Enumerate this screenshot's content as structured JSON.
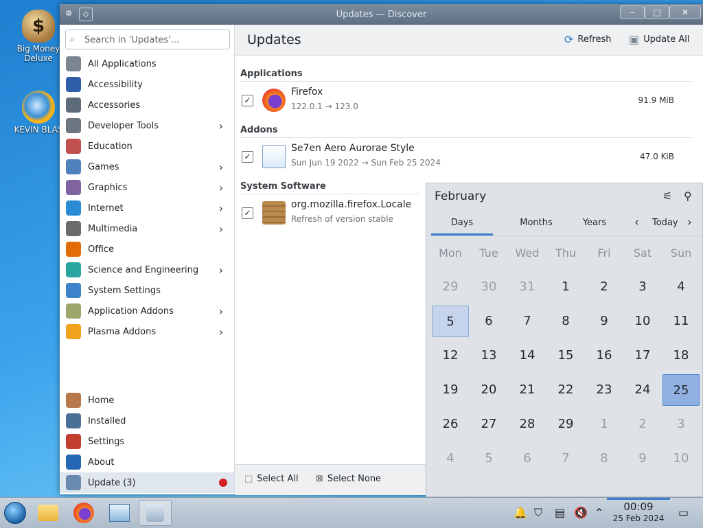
{
  "desktop": {
    "icons": [
      {
        "label": "Big Money Deluxe",
        "glyph": "$"
      },
      {
        "label": "KEVIN BLAS"
      }
    ]
  },
  "window": {
    "title": "Updates — Discover"
  },
  "sidebar": {
    "search_placeholder": "Search in 'Updates'...",
    "categories": [
      {
        "label": "All Applications",
        "icon": "grid-icon",
        "color": "#7a8591"
      },
      {
        "label": "Accessibility",
        "icon": "accessibility-icon",
        "color": "#2f5ea8"
      },
      {
        "label": "Accessories",
        "icon": "accessories-icon",
        "color": "#5d6b7a"
      },
      {
        "label": "Developer Tools",
        "icon": "developer-tools-icon",
        "color": "#6d7680"
      },
      {
        "label": "Education",
        "icon": "education-icon",
        "color": "#c0504d"
      },
      {
        "label": "Games",
        "icon": "games-icon",
        "color": "#4f81bd"
      },
      {
        "label": "Graphics",
        "icon": "graphics-icon",
        "color": "#8064a2"
      },
      {
        "label": "Internet",
        "icon": "internet-icon",
        "color": "#2a8ad4"
      },
      {
        "label": "Multimedia",
        "icon": "multimedia-icon",
        "color": "#6b6b6b"
      },
      {
        "label": "Office",
        "icon": "office-icon",
        "color": "#e36c09"
      },
      {
        "label": "Science and Engineering",
        "icon": "science-icon",
        "color": "#2aa6a0"
      },
      {
        "label": "System Settings",
        "icon": "system-settings-icon",
        "color": "#3c83c9"
      },
      {
        "label": "Application Addons",
        "icon": "application-addons-icon",
        "color": "#9ea56b"
      },
      {
        "label": "Plasma Addons",
        "icon": "plasma-addons-icon",
        "color": "#f0a21a"
      }
    ],
    "bottom": [
      {
        "label": "Home",
        "icon": "home-icon",
        "color": "#b9784a"
      },
      {
        "label": "Installed",
        "icon": "installed-icon",
        "color": "#4a6f97"
      },
      {
        "label": "Settings",
        "icon": "settings-icon",
        "color": "#c33d2e"
      },
      {
        "label": "About",
        "icon": "about-icon",
        "color": "#2566b5"
      },
      {
        "label": "Update (3)",
        "icon": "update-icon",
        "color": "#6a8bb0"
      }
    ]
  },
  "main": {
    "title": "Updates",
    "refresh": "Refresh",
    "update_all": "Update All",
    "sections": [
      {
        "label": "Applications"
      },
      {
        "label": "Addons"
      },
      {
        "label": "System Software"
      }
    ],
    "updates": [
      {
        "name": "Firefox",
        "sub": "122.0.1 → 123.0",
        "size": "91.9 MiB",
        "checked": "✓"
      },
      {
        "name": "Se7en Aero Aurorae Style",
        "sub": "Sun Jun 19 2022 → Sun Feb 25 2024",
        "size": "47.0 KiB",
        "checked": "✓"
      },
      {
        "name": "org.mozilla.firefox.Locale",
        "sub": "Refresh of version stable",
        "size": "",
        "checked": "✓"
      }
    ],
    "select_all": "Select All",
    "select_none": "Select None"
  },
  "calendar": {
    "month": "February",
    "tabs": [
      "Days",
      "Months",
      "Years"
    ],
    "today": "Today",
    "weekdays": [
      "Mon",
      "Tue",
      "Wed",
      "Thu",
      "Fri",
      "Sat",
      "Sun"
    ],
    "days": [
      "29",
      "30",
      "31",
      "1",
      "2",
      "3",
      "4",
      "5",
      "6",
      "7",
      "8",
      "9",
      "10",
      "11",
      "12",
      "13",
      "14",
      "15",
      "16",
      "17",
      "18",
      "19",
      "20",
      "21",
      "22",
      "23",
      "24",
      "25",
      "26",
      "27",
      "28",
      "29",
      "1",
      "2",
      "3",
      "4",
      "5",
      "6",
      "7",
      "8",
      "9",
      "10"
    ],
    "today_index": 27,
    "hover_index": 7
  },
  "taskbar": {
    "time": "00:09",
    "date": "25 Feb 2024"
  }
}
